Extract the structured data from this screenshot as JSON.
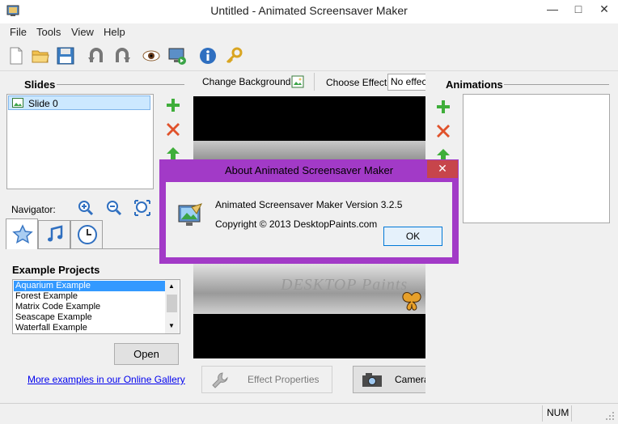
{
  "window": {
    "title": "Untitled - Animated Screensaver Maker",
    "minimize": "—",
    "restore": "□",
    "close": "✕"
  },
  "menu": [
    "File",
    "Tools",
    "View",
    "Help"
  ],
  "slides": {
    "title": "Slides",
    "items": [
      "Slide 0"
    ]
  },
  "navigator": {
    "label": "Navigator:"
  },
  "example_projects": {
    "title": "Example Projects",
    "items": [
      "Aquarium Example",
      "Forest Example",
      "Matrix Code Example",
      "Seascape Example",
      "Waterfall Example"
    ],
    "open_label": "Open",
    "gallery_link": "More examples in our Online Gallery"
  },
  "center": {
    "change_background": "Change Background",
    "choose_effect_label": "Choose Effect:",
    "choose_effect_value": "No effect",
    "logo_text": "DESKTOP Paints",
    "effect_properties": "Effect Properties",
    "camera": "Camera"
  },
  "animations": {
    "title": "Animations"
  },
  "status": {
    "num": "NUM"
  },
  "dialog": {
    "title": "About Animated Screensaver Maker",
    "version": "Animated Screensaver Maker Version 3.2.5",
    "copyright": "Copyright © 2013 DesktopPaints.com",
    "ok": "OK",
    "close": "✕"
  },
  "colors": {
    "dialog_frame": "#a23ac7",
    "close_red": "#c7454b",
    "selection": "#cce8ff"
  }
}
